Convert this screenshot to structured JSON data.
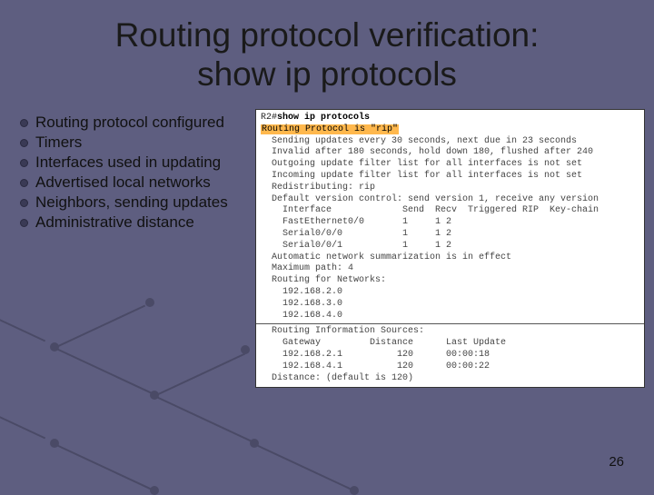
{
  "title_line1": "Routing protocol verification:",
  "title_line2": "show ip protocols",
  "bullets": [
    "Routing protocol configured",
    "Timers",
    "Interfaces used in updating",
    "Advertised local networks",
    "Neighbors, sending updates",
    "Administrative distance"
  ],
  "terminal": {
    "prompt": "R2#",
    "command": "show ip protocols",
    "line_protocol": "Routing Protocol is \"rip\"",
    "body1": "  Sending updates every 30 seconds, next due in 23 seconds\n  Invalid after 180 seconds, hold down 180, flushed after 240\n  Outgoing update filter list for all interfaces is not set\n  Incoming update filter list for all interfaces is not set\n  Redistributing: rip\n  Default version control: send version 1, receive any version\n    Interface             Send  Recv  Triggered RIP  Key-chain\n    FastEthernet0/0       1     1 2\n    Serial0/0/0           1     1 2\n    Serial0/0/1           1     1 2\n  Automatic network summarization is in effect\n  Maximum path: 4\n  Routing for Networks:\n    192.168.2.0\n    192.168.3.0\n    192.168.4.0",
    "body2": "  Routing Information Sources:\n    Gateway         Distance      Last Update\n    192.168.2.1          120      00:00:18\n    192.168.4.1          120      00:00:22\n  Distance: (default is 120)"
  },
  "page_number": "26"
}
